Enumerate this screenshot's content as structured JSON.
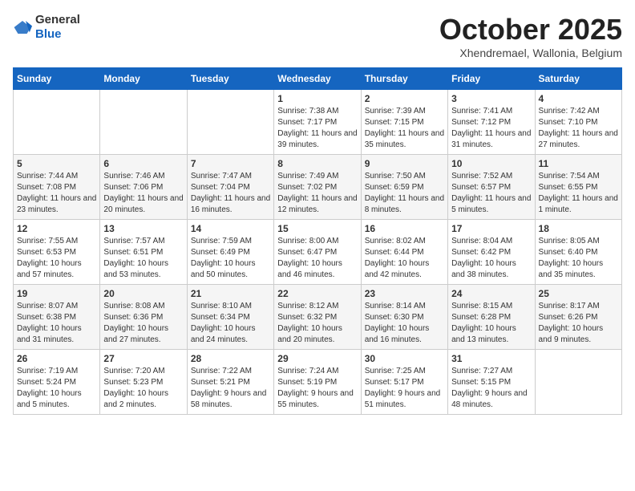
{
  "header": {
    "logo_general": "General",
    "logo_blue": "Blue",
    "month_title": "October 2025",
    "subtitle": "Xhendremael, Wallonia, Belgium"
  },
  "weekdays": [
    "Sunday",
    "Monday",
    "Tuesday",
    "Wednesday",
    "Thursday",
    "Friday",
    "Saturday"
  ],
  "weeks": [
    [
      {
        "day": "",
        "info": ""
      },
      {
        "day": "",
        "info": ""
      },
      {
        "day": "",
        "info": ""
      },
      {
        "day": "1",
        "info": "Sunrise: 7:38 AM\nSunset: 7:17 PM\nDaylight: 11 hours and 39 minutes."
      },
      {
        "day": "2",
        "info": "Sunrise: 7:39 AM\nSunset: 7:15 PM\nDaylight: 11 hours and 35 minutes."
      },
      {
        "day": "3",
        "info": "Sunrise: 7:41 AM\nSunset: 7:12 PM\nDaylight: 11 hours and 31 minutes."
      },
      {
        "day": "4",
        "info": "Sunrise: 7:42 AM\nSunset: 7:10 PM\nDaylight: 11 hours and 27 minutes."
      }
    ],
    [
      {
        "day": "5",
        "info": "Sunrise: 7:44 AM\nSunset: 7:08 PM\nDaylight: 11 hours and 23 minutes."
      },
      {
        "day": "6",
        "info": "Sunrise: 7:46 AM\nSunset: 7:06 PM\nDaylight: 11 hours and 20 minutes."
      },
      {
        "day": "7",
        "info": "Sunrise: 7:47 AM\nSunset: 7:04 PM\nDaylight: 11 hours and 16 minutes."
      },
      {
        "day": "8",
        "info": "Sunrise: 7:49 AM\nSunset: 7:02 PM\nDaylight: 11 hours and 12 minutes."
      },
      {
        "day": "9",
        "info": "Sunrise: 7:50 AM\nSunset: 6:59 PM\nDaylight: 11 hours and 8 minutes."
      },
      {
        "day": "10",
        "info": "Sunrise: 7:52 AM\nSunset: 6:57 PM\nDaylight: 11 hours and 5 minutes."
      },
      {
        "day": "11",
        "info": "Sunrise: 7:54 AM\nSunset: 6:55 PM\nDaylight: 11 hours and 1 minute."
      }
    ],
    [
      {
        "day": "12",
        "info": "Sunrise: 7:55 AM\nSunset: 6:53 PM\nDaylight: 10 hours and 57 minutes."
      },
      {
        "day": "13",
        "info": "Sunrise: 7:57 AM\nSunset: 6:51 PM\nDaylight: 10 hours and 53 minutes."
      },
      {
        "day": "14",
        "info": "Sunrise: 7:59 AM\nSunset: 6:49 PM\nDaylight: 10 hours and 50 minutes."
      },
      {
        "day": "15",
        "info": "Sunrise: 8:00 AM\nSunset: 6:47 PM\nDaylight: 10 hours and 46 minutes."
      },
      {
        "day": "16",
        "info": "Sunrise: 8:02 AM\nSunset: 6:44 PM\nDaylight: 10 hours and 42 minutes."
      },
      {
        "day": "17",
        "info": "Sunrise: 8:04 AM\nSunset: 6:42 PM\nDaylight: 10 hours and 38 minutes."
      },
      {
        "day": "18",
        "info": "Sunrise: 8:05 AM\nSunset: 6:40 PM\nDaylight: 10 hours and 35 minutes."
      }
    ],
    [
      {
        "day": "19",
        "info": "Sunrise: 8:07 AM\nSunset: 6:38 PM\nDaylight: 10 hours and 31 minutes."
      },
      {
        "day": "20",
        "info": "Sunrise: 8:08 AM\nSunset: 6:36 PM\nDaylight: 10 hours and 27 minutes."
      },
      {
        "day": "21",
        "info": "Sunrise: 8:10 AM\nSunset: 6:34 PM\nDaylight: 10 hours and 24 minutes."
      },
      {
        "day": "22",
        "info": "Sunrise: 8:12 AM\nSunset: 6:32 PM\nDaylight: 10 hours and 20 minutes."
      },
      {
        "day": "23",
        "info": "Sunrise: 8:14 AM\nSunset: 6:30 PM\nDaylight: 10 hours and 16 minutes."
      },
      {
        "day": "24",
        "info": "Sunrise: 8:15 AM\nSunset: 6:28 PM\nDaylight: 10 hours and 13 minutes."
      },
      {
        "day": "25",
        "info": "Sunrise: 8:17 AM\nSunset: 6:26 PM\nDaylight: 10 hours and 9 minutes."
      }
    ],
    [
      {
        "day": "26",
        "info": "Sunrise: 7:19 AM\nSunset: 5:24 PM\nDaylight: 10 hours and 5 minutes."
      },
      {
        "day": "27",
        "info": "Sunrise: 7:20 AM\nSunset: 5:23 PM\nDaylight: 10 hours and 2 minutes."
      },
      {
        "day": "28",
        "info": "Sunrise: 7:22 AM\nSunset: 5:21 PM\nDaylight: 9 hours and 58 minutes."
      },
      {
        "day": "29",
        "info": "Sunrise: 7:24 AM\nSunset: 5:19 PM\nDaylight: 9 hours and 55 minutes."
      },
      {
        "day": "30",
        "info": "Sunrise: 7:25 AM\nSunset: 5:17 PM\nDaylight: 9 hours and 51 minutes."
      },
      {
        "day": "31",
        "info": "Sunrise: 7:27 AM\nSunset: 5:15 PM\nDaylight: 9 hours and 48 minutes."
      },
      {
        "day": "",
        "info": ""
      }
    ]
  ]
}
